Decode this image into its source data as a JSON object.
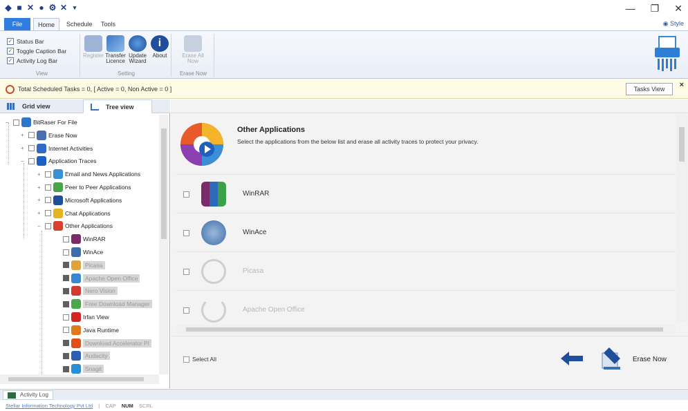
{
  "window": {
    "controls": {
      "minimize": "—",
      "maximize": "❐",
      "close": "✕"
    }
  },
  "ribbon": {
    "tabs": [
      {
        "label": "File"
      },
      {
        "label": "Home"
      },
      {
        "label": "Schedule"
      },
      {
        "label": "Tools"
      }
    ],
    "style_label": "Style",
    "view_group": {
      "title": "View",
      "options": [
        {
          "label": "Status Bar",
          "checked": true
        },
        {
          "label": "Toggle Caption Bar",
          "checked": true
        },
        {
          "label": "Activity Log Bar",
          "checked": true
        }
      ]
    },
    "setting_group": {
      "title": "Setting",
      "buttons": [
        {
          "label": "Register",
          "icon": "register-icon",
          "enabled": false
        },
        {
          "label": "Transfer Licence",
          "icon": "transfer-licence-icon",
          "enabled": true
        },
        {
          "label": "Update Wizard",
          "icon": "globe-icon",
          "enabled": true
        },
        {
          "label": "About",
          "icon": "info-icon",
          "enabled": true
        }
      ]
    },
    "erase_group": {
      "title": "Erase Now",
      "buttons": [
        {
          "label": "Erase All Now",
          "icon": "erase-all-icon",
          "enabled": false
        }
      ]
    }
  },
  "infobar": {
    "text": "Total Scheduled Tasks = 0, [ Active = 0, Non Active = 0 ]",
    "tasks_view_label": "Tasks View",
    "close": "×"
  },
  "left_panel": {
    "tabs": [
      {
        "label": "Grid view",
        "active": false
      },
      {
        "label": "Tree view",
        "active": true
      }
    ],
    "tree": [
      {
        "label": "BitRaser For File",
        "level": 0,
        "expand": "−",
        "icon_color": "#2b78c8"
      },
      {
        "label": "Erase Now",
        "level": 1,
        "expand": "+",
        "icon_color": "#4a6fb0"
      },
      {
        "label": "Internet Activities",
        "level": 1,
        "expand": "+",
        "icon_color": "#2f6bc4"
      },
      {
        "label": "Application Traces",
        "level": 1,
        "expand": "−",
        "icon_color": "#1d5fc2"
      },
      {
        "label": "Email and News Applications",
        "level": 2,
        "expand": "+",
        "icon_color": "#3b8fd6"
      },
      {
        "label": "Peer to Peer Applications",
        "level": 2,
        "expand": "+",
        "icon_color": "#48a34a"
      },
      {
        "label": "Microsoft Applications",
        "level": 2,
        "expand": "+",
        "icon_color": "#1f4e9a"
      },
      {
        "label": "Chat Applications",
        "level": 2,
        "expand": "+",
        "icon_color": "#e6b21f"
      },
      {
        "label": "Other Applications",
        "level": 2,
        "expand": "−",
        "icon_color": "#d8412b"
      },
      {
        "label": "WinRAR",
        "level": 3,
        "dim": false,
        "dark_cb": false,
        "icon_color": "#7b2a6a"
      },
      {
        "label": "WinAce",
        "level": 3,
        "dim": false,
        "dark_cb": false,
        "icon_color": "#3e6ea8"
      },
      {
        "label": "Picasa",
        "level": 3,
        "dim": true,
        "dark_cb": true,
        "icon_color": "#e0a23a"
      },
      {
        "label": "Apache Open Office",
        "level": 3,
        "dim": true,
        "dark_cb": true,
        "icon_color": "#3a86d1"
      },
      {
        "label": "Nero Vision",
        "level": 3,
        "dim": true,
        "dark_cb": true,
        "icon_color": "#d13a2e"
      },
      {
        "label": "Free Download Manager",
        "level": 3,
        "dim": true,
        "dark_cb": true,
        "icon_color": "#4aa84a"
      },
      {
        "label": "Irfan View",
        "level": 3,
        "dim": false,
        "dark_cb": false,
        "icon_color": "#d22626"
      },
      {
        "label": "Java Runtime",
        "level": 3,
        "dim": false,
        "dark_cb": false,
        "icon_color": "#e07a1a"
      },
      {
        "label": "Download Accelerator Pl",
        "level": 3,
        "dim": true,
        "dark_cb": true,
        "icon_color": "#e0501a"
      },
      {
        "label": "Audacity",
        "level": 3,
        "dim": true,
        "dark_cb": true,
        "icon_color": "#2a5fb4"
      },
      {
        "label": "Snagit",
        "level": 3,
        "dim": true,
        "dark_cb": true,
        "icon_color": "#2a8ed6"
      }
    ]
  },
  "right_panel": {
    "title": "Other Applications",
    "description": "Select the applications from the below list and erase all activity traces to protect your privacy.",
    "apps": [
      {
        "label": "WinRAR",
        "enabled": true,
        "icon": "winrar-icon",
        "color": "#7b2a6a"
      },
      {
        "label": "WinAce",
        "enabled": true,
        "icon": "winace-icon",
        "color": "#3e6ea8"
      },
      {
        "label": "Picasa",
        "enabled": false,
        "icon": "picasa-icon",
        "color": "#cfcfcf"
      },
      {
        "label": "Apache Open Office",
        "enabled": false,
        "icon": "openoffice-icon",
        "color": "#cfcfcf"
      }
    ],
    "select_all_label": "Select All",
    "erase_now_label": "Erase Now"
  },
  "activity_log_tab": "Activity Log",
  "statusbar": {
    "company": "Stellar Information Technology Pvt Ltd",
    "separator": "|",
    "keys": [
      {
        "label": "CAP",
        "on": false
      },
      {
        "label": "NUM",
        "on": true
      },
      {
        "label": "SCRL",
        "on": false
      }
    ]
  },
  "colors": {
    "accent": "#2f7de0",
    "infobar_bg": "#fdfbe3",
    "panel_border": "#8fb3de"
  }
}
